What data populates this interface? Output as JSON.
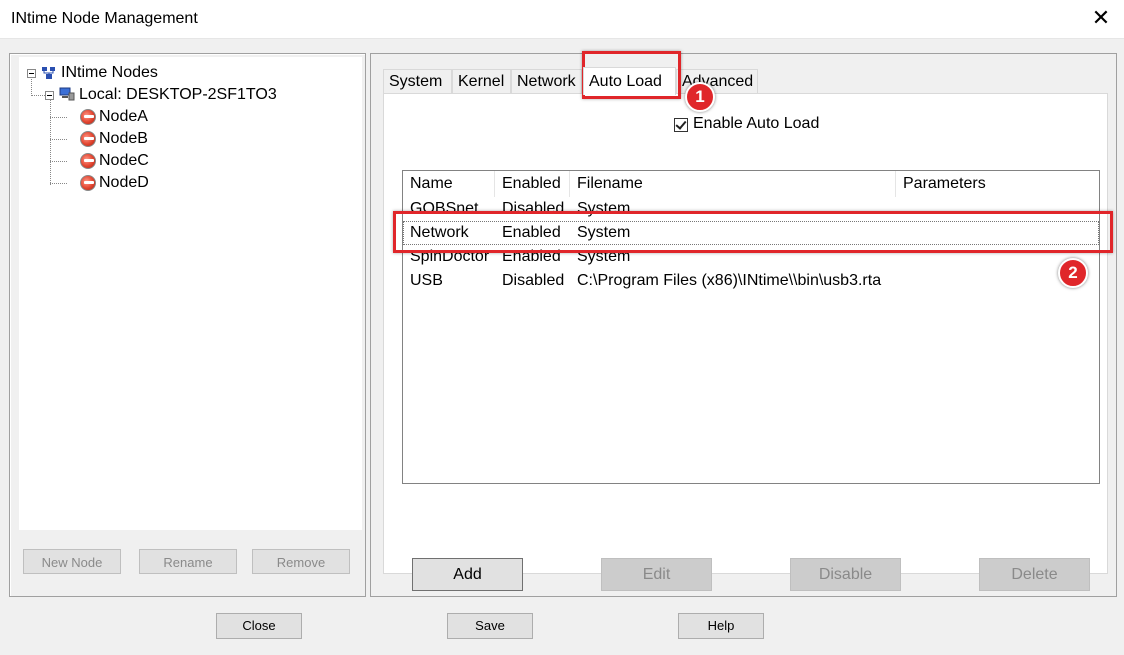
{
  "window": {
    "title": "INtime Node Management",
    "close_glyph": "✕"
  },
  "tree": {
    "root": "INtime Nodes",
    "host": "Local: DESKTOP-2SF1TO3",
    "nodes": [
      "NodeA",
      "NodeB",
      "NodeC",
      "NodeD"
    ],
    "selected": "NodeA"
  },
  "left_buttons": {
    "new_node": "New Node",
    "rename": "Rename",
    "remove": "Remove"
  },
  "tabs": [
    "System",
    "Kernel",
    "Network",
    "Auto Load",
    "Advanced"
  ],
  "active_tab": "Auto Load",
  "autoload": {
    "enable_label": "Enable Auto Load",
    "enabled": true,
    "columns": [
      "Name",
      "Enabled",
      "Filename",
      "Parameters"
    ],
    "rows": [
      {
        "name": "GOBSnet",
        "enabled": "Disabled",
        "filename": "System",
        "parameters": ""
      },
      {
        "name": "Network",
        "enabled": "Enabled",
        "filename": "System",
        "parameters": ""
      },
      {
        "name": "SpinDoctor",
        "enabled": "Enabled",
        "filename": "System",
        "parameters": ""
      },
      {
        "name": "USB",
        "enabled": "Disabled",
        "filename": "C:\\Program Files (x86)\\INtime\\\\bin\\usb3.rta",
        "parameters": ""
      }
    ],
    "selected_row": "Network"
  },
  "actions": {
    "add": "Add",
    "edit": "Edit",
    "disable": "Disable",
    "delete": "Delete"
  },
  "bottom_buttons": {
    "close": "Close",
    "save": "Save",
    "help": "Help"
  },
  "annotations": {
    "badge1": "1",
    "badge2": "2",
    "color": "#e0262a"
  }
}
